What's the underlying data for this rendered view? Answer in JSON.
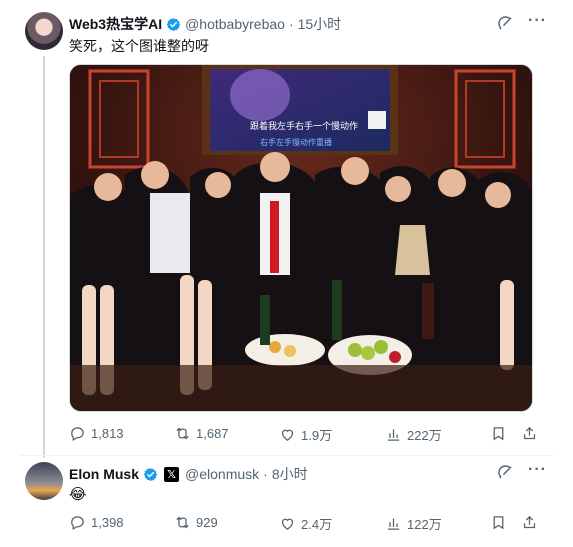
{
  "post1": {
    "display_name": "Web3热宝学AI",
    "handle": "@hotbabyrebao",
    "separator": "·",
    "time": "15小时",
    "text": "笑死，这个图谁整的呀",
    "media_caption_line1": "跟着我左手右手一个慢动作",
    "media_caption_line2": "右手左手慢动作重播",
    "stats": {
      "replies": "1,813",
      "reposts": "1,687",
      "likes": "1.9万",
      "views": "222万"
    }
  },
  "post2": {
    "display_name": "Elon Musk",
    "x_badge": "𝕏",
    "handle": "@elonmusk",
    "separator": "·",
    "time": "8小时",
    "text": "😂",
    "stats": {
      "replies": "1,398",
      "reposts": "929",
      "likes": "2.4万",
      "views": "122万"
    }
  },
  "colors": {
    "verified": "#1d9bf0",
    "muted": "#536471",
    "text": "#0f1419",
    "border": "#cfd9de"
  },
  "icons": [
    "verified-badge-icon",
    "grok-icon",
    "more-icon",
    "reply-icon",
    "repost-icon",
    "like-icon",
    "views-icon",
    "bookmark-icon",
    "share-icon"
  ]
}
